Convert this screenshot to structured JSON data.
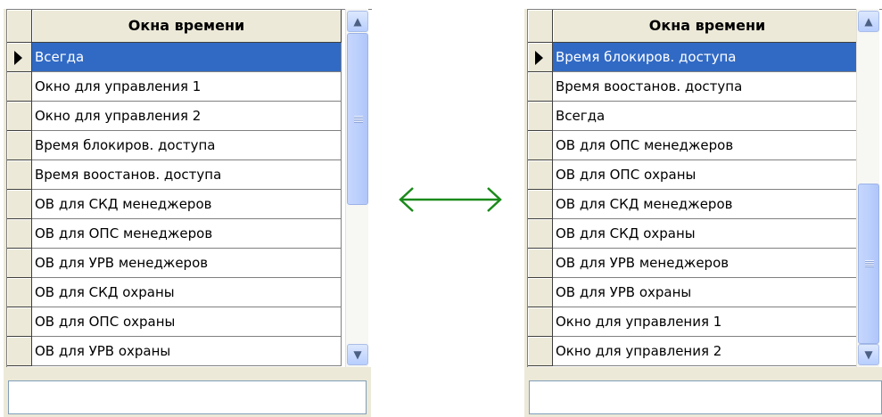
{
  "left_panel": {
    "column_header": "Окна времени",
    "selected_index": 0,
    "rows": [
      {
        "label": "Всегда"
      },
      {
        "label": "Окно для управления 1"
      },
      {
        "label": "Окно для управления 2"
      },
      {
        "label": "Время блокиров. доступа"
      },
      {
        "label": "Время воостанов. доступа"
      },
      {
        "label": "ОВ для СКД менеджеров"
      },
      {
        "label": "ОВ для ОПС менеджеров"
      },
      {
        "label": "ОВ для УРВ менеджеров"
      },
      {
        "label": "ОВ для СКД охраны"
      },
      {
        "label": "ОВ для ОПС охраны"
      },
      {
        "label": "ОВ для УРВ охраны"
      }
    ],
    "footer_value": ""
  },
  "right_panel": {
    "column_header": "Окна времени",
    "selected_index": 0,
    "rows": [
      {
        "label": "Время блокиров. доступа"
      },
      {
        "label": "Время воостанов. доступа"
      },
      {
        "label": "Всегда"
      },
      {
        "label": "ОВ для ОПС менеджеров"
      },
      {
        "label": "ОВ для ОПС охраны"
      },
      {
        "label": "ОВ для СКД менеджеров"
      },
      {
        "label": "ОВ для СКД охраны"
      },
      {
        "label": "ОВ для УРВ менеджеров"
      },
      {
        "label": "ОВ для УРВ охраны"
      },
      {
        "label": "Окно для управления 1"
      },
      {
        "label": "Окно для управления 2"
      }
    ],
    "footer_value": ""
  },
  "colors": {
    "selection": "#316ac5",
    "arrow": "#1a8a1a",
    "panel_bg": "#ece9d8"
  },
  "icons": {
    "scroll_up": "chevron-up-icon",
    "scroll_down": "chevron-down-icon",
    "current_row": "row-pointer-icon",
    "between_panels": "double-arrow-icon"
  }
}
